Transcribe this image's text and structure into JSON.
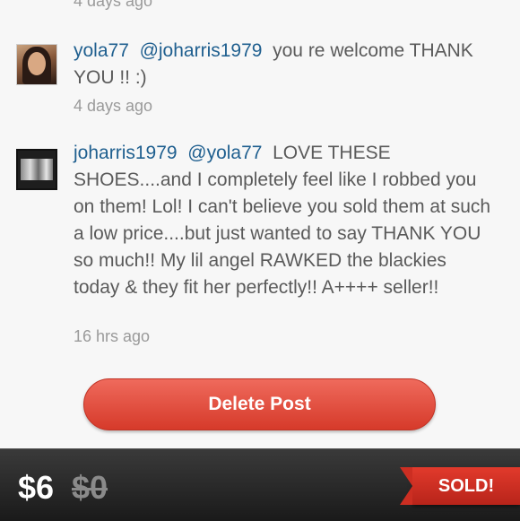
{
  "previous_comment": {
    "timestamp": "4 days ago"
  },
  "comments": [
    {
      "username": "yola77",
      "mention": "@joharris1979",
      "text": "you re welcome THANK YOU !! :)",
      "timestamp": "4 days ago"
    },
    {
      "username": "joharris1979",
      "mention": "@yola77",
      "text": "LOVE THESE SHOES....and I completely feel like I robbed you on them!  Lol!  I can't believe you sold them at such a low price....but just wanted to say THANK YOU so much!! My lil angel RAWKED the blackies today & they fit her perfectly!!  A++++ seller!!",
      "timestamp": "16 hrs ago"
    }
  ],
  "actions": {
    "delete_label": "Delete Post"
  },
  "listing": {
    "price": "$6",
    "original_price": "$0",
    "status_badge": "SOLD!"
  },
  "colors": {
    "link": "#1f5f8f",
    "button_red": "#d63a2a",
    "sold_red": "#c9281c"
  }
}
